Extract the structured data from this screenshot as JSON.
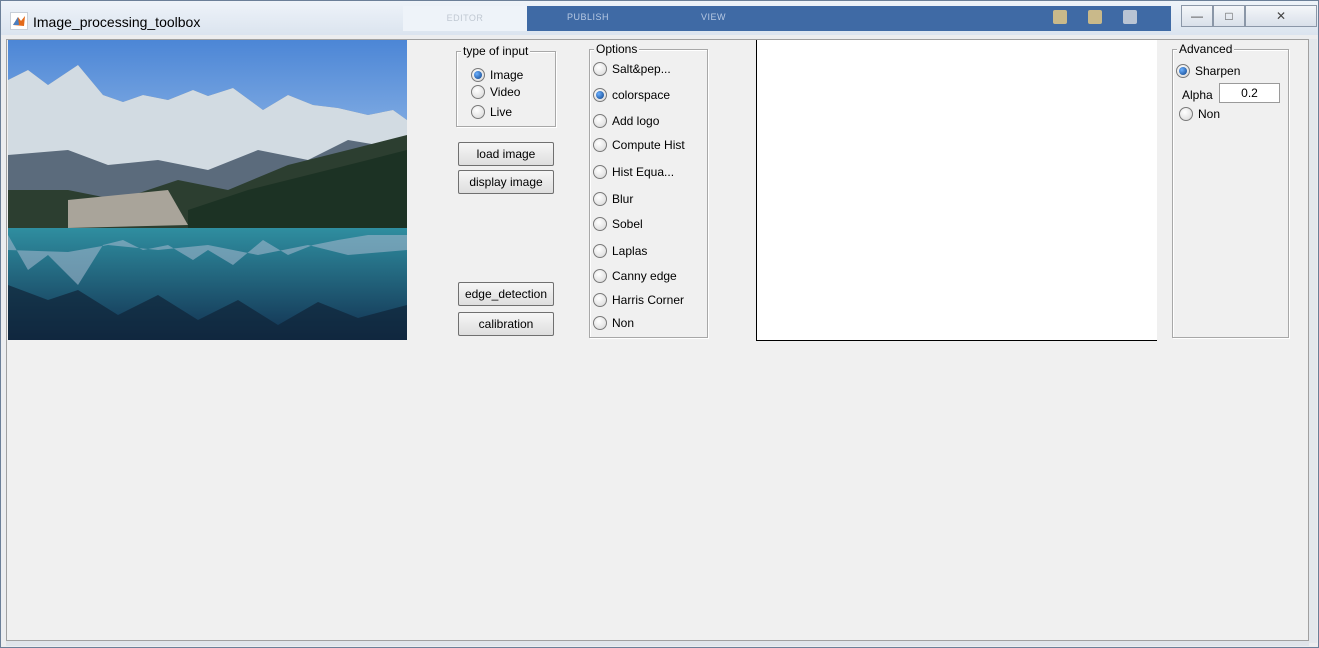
{
  "window": {
    "title": "Image_processing_toolbox",
    "background_tabs": [
      "EDITOR",
      "PUBLISH",
      "VIEW"
    ],
    "controls": {
      "minimize": "—",
      "maximize": "□",
      "close": "✕"
    }
  },
  "image_panel": {
    "icon": "mountain-lake-photo"
  },
  "input_type": {
    "title": "type of input",
    "options": [
      {
        "label": "Image",
        "selected": true
      },
      {
        "label": "Video",
        "selected": false
      },
      {
        "label": "Live",
        "selected": false
      }
    ]
  },
  "buttons": {
    "load": "load image",
    "display": "display image",
    "edge": "edge_detection",
    "calibration": "calibration"
  },
  "options": {
    "title": "Options",
    "items": [
      {
        "label": "Salt&pep...",
        "selected": false
      },
      {
        "label": "colorspace",
        "selected": true
      },
      {
        "label": "Add logo",
        "selected": false
      },
      {
        "label": "Compute Hist",
        "selected": false
      },
      {
        "label": "Hist Equa...",
        "selected": false
      },
      {
        "label": "Blur",
        "selected": false
      },
      {
        "label": "Sobel",
        "selected": false
      },
      {
        "label": "Laplas",
        "selected": false
      },
      {
        "label": "Canny edge",
        "selected": false
      },
      {
        "label": "Harris Corner",
        "selected": false
      },
      {
        "label": "Non",
        "selected": false
      }
    ]
  },
  "advanced": {
    "title": "Advanced",
    "sharpen": {
      "label": "Sharpen",
      "selected": true
    },
    "alpha_label": "Alpha",
    "alpha_value": "0.2",
    "non": {
      "label": "Non",
      "selected": false
    }
  },
  "colors": {
    "titlebar": "#dbe4ef",
    "client": "#f0f0f0",
    "accent": "#0b3f86"
  }
}
